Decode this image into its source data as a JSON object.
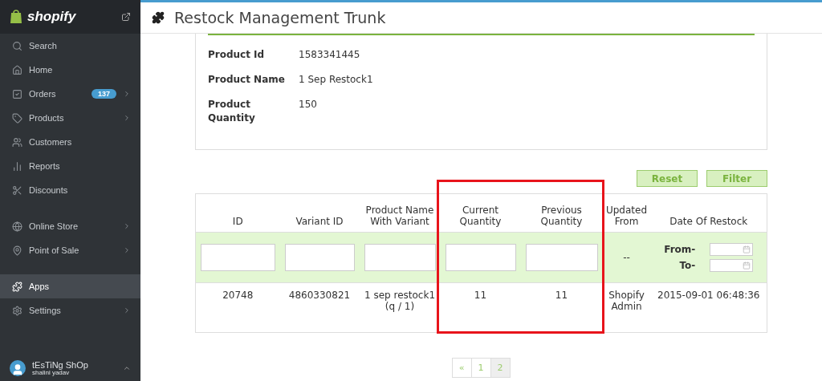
{
  "sidebar": {
    "brand": "shopify",
    "sections": [
      {
        "items": [
          {
            "label": "Search",
            "selected": false,
            "arrow": false
          },
          {
            "label": "Home",
            "selected": false,
            "arrow": false
          },
          {
            "label": "Orders",
            "selected": false,
            "arrow": true,
            "badge": "137"
          },
          {
            "label": "Products",
            "selected": false,
            "arrow": true
          },
          {
            "label": "Customers",
            "selected": false,
            "arrow": false
          },
          {
            "label": "Reports",
            "selected": false,
            "arrow": false
          },
          {
            "label": "Discounts",
            "selected": false,
            "arrow": false
          }
        ]
      },
      {
        "items": [
          {
            "label": "Online Store",
            "selected": false,
            "arrow": true
          },
          {
            "label": "Point of Sale",
            "selected": false,
            "arrow": true
          }
        ]
      },
      {
        "items": [
          {
            "label": "Apps",
            "selected": true,
            "arrow": false
          },
          {
            "label": "Settings",
            "selected": false,
            "arrow": true
          }
        ]
      }
    ],
    "user": {
      "shop": "tEsTiNg ShOp",
      "name": "shalini yadav"
    }
  },
  "page": {
    "title": "Restock Management Trunk"
  },
  "product": [
    {
      "label": "Product Id",
      "value": "1583341445"
    },
    {
      "label": "Product Name",
      "value": "1 Sep Restock1"
    },
    {
      "label": "Product Quantity",
      "value": "150"
    }
  ],
  "buttons": [
    "Reset",
    "Filter"
  ],
  "table": {
    "columns": [
      "ID",
      "Variant ID",
      "Product Name With Variant",
      "Current Quantity",
      "Previous Quantity",
      "Updated From",
      "Date Of Restock"
    ],
    "filters": {
      "updated_from": "--",
      "from_label": "From-",
      "to_label": "To-"
    },
    "rows": [
      [
        "20748",
        "4860330821",
        "1 sep restock1 (q / 1)",
        "11",
        "11",
        "Shopify Admin",
        "2015-09-01 06:48:36"
      ]
    ]
  },
  "pagination": [
    {
      "label": "«",
      "selected": false
    },
    {
      "label": "1",
      "selected": false
    },
    {
      "label": "2",
      "selected": true
    }
  ]
}
